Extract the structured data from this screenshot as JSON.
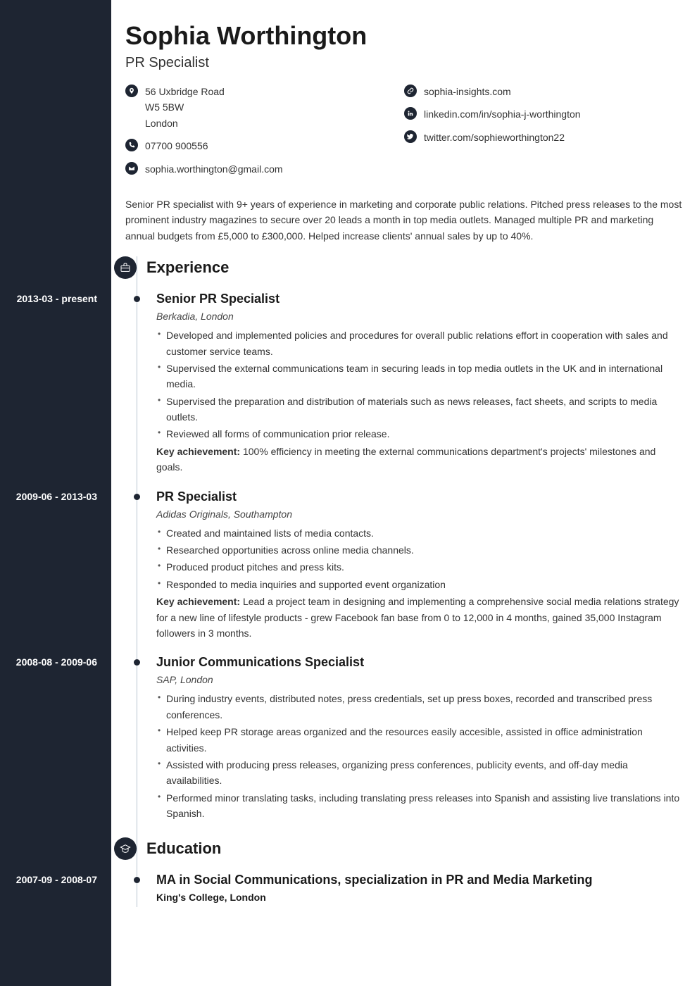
{
  "header": {
    "name": "Sophia Worthington",
    "title": "PR Specialist"
  },
  "contact_left": [
    {
      "icon": "location-icon",
      "lines": [
        "56 Uxbridge Road",
        "W5 5BW",
        "London"
      ]
    },
    {
      "icon": "phone-icon",
      "lines": [
        "07700 900556"
      ]
    },
    {
      "icon": "email-icon",
      "lines": [
        "sophia.worthington@gmail.com"
      ]
    }
  ],
  "contact_right": [
    {
      "icon": "link-icon",
      "lines": [
        "sophia-insights.com"
      ]
    },
    {
      "icon": "linkedin-icon",
      "lines": [
        "linkedin.com/in/sophia-j-worthington"
      ]
    },
    {
      "icon": "twitter-icon",
      "lines": [
        "twitter.com/sophieworthington22"
      ]
    }
  ],
  "summary": "Senior PR specialist with 9+ years of experience in marketing and corporate public relations. Pitched press releases to the most prominent industry magazines to secure over 20 leads a month in top media outlets. Managed multiple PR and marketing annual budgets from £5,000 to £300,000. Helped increase clients' annual sales by up to 40%.",
  "sections": {
    "experience": {
      "title": "Experience",
      "entries": [
        {
          "date": "2013-03 - present",
          "title": "Senior PR Specialist",
          "company": "Berkadia, London",
          "bullets": [
            "Developed and implemented policies and procedures for overall public relations effort in cooperation with sales and customer service teams.",
            "Supervised the external communications team in securing leads in top media outlets in the UK and in international media.",
            "Supervised the preparation and distribution of materials such as news releases, fact sheets, and scripts to media outlets.",
            "Reviewed all forms of communication prior release."
          ],
          "achievement_label": "Key achievement:",
          "achievement": " 100% efficiency in meeting the external communications department's projects' milestones and goals."
        },
        {
          "date": "2009-06 - 2013-03",
          "title": "PR Specialist",
          "company": "Adidas Originals, Southampton",
          "bullets": [
            "Created and maintained lists of media contacts.",
            "Researched opportunities across online media channels.",
            "Produced product pitches and press kits.",
            "Responded to media inquiries and supported event organization"
          ],
          "achievement_label": "Key achievement:",
          "achievement": " Lead a project team in designing and implementing a comprehensive social media relations strategy for a new line of lifestyle products - grew Facebook fan base from 0 to 12,000 in 4 months, gained 35,000 Instagram followers in 3 months."
        },
        {
          "date": "2008-08 - 2009-06",
          "title": "Junior Communications Specialist",
          "company": "SAP, London",
          "bullets": [
            "During industry events, distributed notes, press credentials, set up press boxes, recorded and transcribed press conferences.",
            "Helped keep PR storage areas organized and the resources easily accesible, assisted in office administration activities.",
            "Assisted with producing press releases, organizing press conferences, publicity events, and off-day media availabilities.",
            "Performed minor translating tasks, including translating press releases into Spanish and assisting live translations into Spanish."
          ]
        }
      ]
    },
    "education": {
      "title": "Education",
      "entries": [
        {
          "date": "2007-09 - 2008-07",
          "title": "MA in Social Communications, specialization in PR and Media Marketing",
          "school": "King's College, London"
        }
      ]
    }
  }
}
